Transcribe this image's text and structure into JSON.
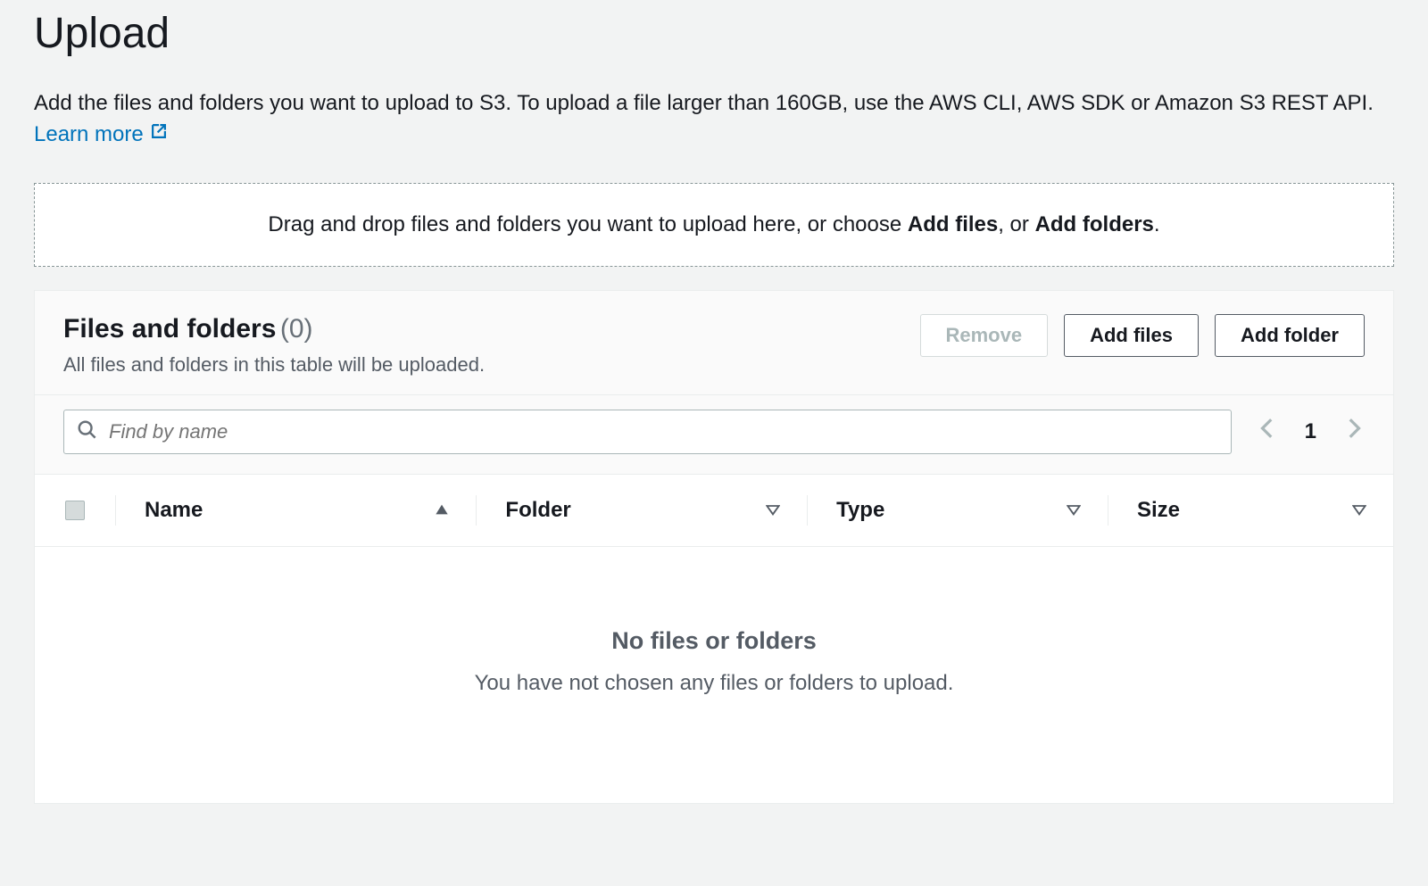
{
  "header": {
    "title": "Upload",
    "description_prefix": "Add the files and folders you want to upload to S3. To upload a file larger than 160GB, use the AWS CLI, AWS SDK or Amazon S3 REST API. ",
    "learn_more": "Learn more"
  },
  "dropzone": {
    "prefix": "Drag and drop files and folders you want to upload here, or choose ",
    "add_files": "Add files",
    "sep": ", or ",
    "add_folders": "Add folders",
    "suffix": "."
  },
  "panel": {
    "title": "Files and folders",
    "count": "(0)",
    "subtitle": "All files and folders in this table will be uploaded."
  },
  "actions": {
    "remove": "Remove",
    "add_files": "Add files",
    "add_folder": "Add folder"
  },
  "search": {
    "placeholder": "Find by name"
  },
  "pagination": {
    "current": "1"
  },
  "columns": {
    "name": "Name",
    "folder": "Folder",
    "type": "Type",
    "size": "Size"
  },
  "empty": {
    "title": "No files or folders",
    "subtitle": "You have not chosen any files or folders to upload."
  }
}
